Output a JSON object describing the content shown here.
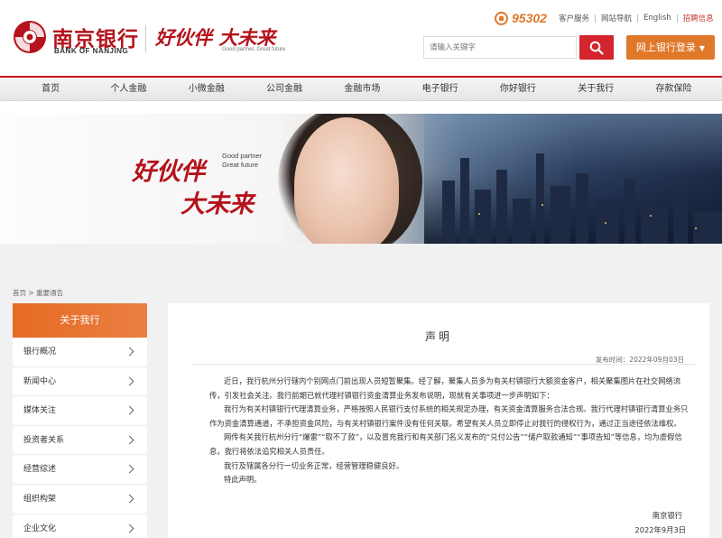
{
  "header": {
    "brand_cn": "南京银行",
    "brand_en": "BANK OF NANJING",
    "slogan_cn": "好伙伴 大未来",
    "slogan_en": "Good partner, Great future",
    "hotline": "95302",
    "top_links": [
      "客户服务",
      "网站导航",
      "English",
      "招聘信息"
    ],
    "search_placeholder": "请输入关键字",
    "login_label": "网上银行登录"
  },
  "nav": {
    "items": [
      "首页",
      "个人金融",
      "小微金融",
      "公司金融",
      "金融市场",
      "电子银行",
      "你好银行",
      "关于我行",
      "存款保险"
    ]
  },
  "banner": {
    "cn_line1": "好伙伴",
    "cn_line2": "大未来",
    "en_line1": "Good partner",
    "en_line2": "Great future"
  },
  "breadcrumb": {
    "home": "首页",
    "sep": ">",
    "current": "重要通告"
  },
  "sidebar": {
    "title": "关于我行",
    "items": [
      "银行概况",
      "新闻中心",
      "媒体关注",
      "投资者关系",
      "经营综述",
      "组织构架",
      "企业文化"
    ]
  },
  "article": {
    "title": "声明",
    "date": "发布时间：2022年09月03日",
    "paragraphs": [
      "近日，我行杭州分行辖内个别网点门前出现人员短暂聚集。经了解，聚集人员多为有关村镇银行大额资金客户，相关聚集图片在社交网络流传，引发社会关注。我行前期已就代理村镇银行资金清算业务发布说明，现就有关事项进一步声明如下：",
      "我行为有关村镇银行代理清算业务，严格按照人民银行支付系统的相关规定办理，有关资金清算服务合法合规。我行代理村镇银行清算业务只作为资金清算通道，不承担资金风险，与有关村镇银行案件没有任何关联。希望有关人员立即停止对我行的侵权行为，通过正当途径依法维权。",
      "网传有关我行杭州分行“爆雷”“取不了款”，以及冒充我行和有关部门名义发布的“兑付公告”“储户取款通知”“事项告知”等信息，均为虚假信息，我行将依法追究相关人员责任。",
      "我行及辖属各分行一切业务正常，经营管理稳健良好。",
      "特此声明。"
    ],
    "signature": "南京银行",
    "sign_date": "2022年9月3日"
  },
  "colors": {
    "brand_red": "#b5121b",
    "search_red": "#d4242d",
    "orange": "#e0782a",
    "sidebar_orange": "#e66a22"
  }
}
